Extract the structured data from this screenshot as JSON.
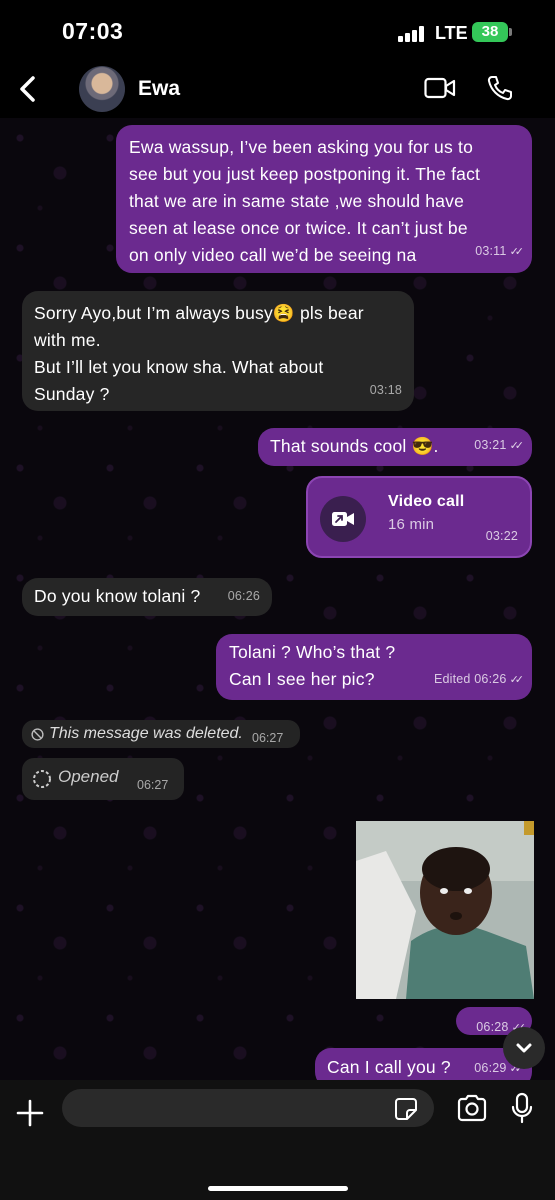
{
  "status_bar": {
    "time": "07:03",
    "network": "LTE",
    "battery": "38"
  },
  "header": {
    "contact_name": "Ewa"
  },
  "messages": [
    {
      "id": "m1",
      "direction": "out",
      "text": "Ewa wassup, I’ve been asking you for us to\nsee but you just keep postponing it. The fact\nthat we are in same state ,we should have\nseen at lease once or twice. It can’t just be\non only video call we’d be seeing na",
      "time": "03:11"
    },
    {
      "id": "m2",
      "direction": "in",
      "text": "Sorry Ayo,but I’m always busy😫 pls bear\nwith me.\nBut I’ll let you know sha. What about\nSunday ?",
      "time": "03:18"
    },
    {
      "id": "m3",
      "direction": "out",
      "text": "That sounds cool 😎.",
      "time": "03:21"
    },
    {
      "id": "m4",
      "direction": "out",
      "type": "call",
      "title": "Video call",
      "duration": "16 min",
      "time": "03:22"
    },
    {
      "id": "m5",
      "direction": "in",
      "text": "Do you know tolani ?",
      "time": "06:26"
    },
    {
      "id": "m6",
      "direction": "out",
      "text": "Tolani ? Who’s that ?\nCan I see her pic?",
      "edited_label": "Edited",
      "time": "06:26"
    },
    {
      "id": "m7",
      "direction": "in",
      "type": "deleted",
      "text": "This message was deleted.",
      "time": "06:27"
    },
    {
      "id": "m8",
      "direction": "in",
      "type": "view_once",
      "text": "Opened",
      "time": "06:27"
    },
    {
      "id": "m9",
      "direction": "out",
      "type": "image",
      "time": "06:28"
    },
    {
      "id": "m10",
      "direction": "out",
      "text": "Can I call you ?",
      "time": "06:29"
    }
  ],
  "input": {
    "placeholder": ""
  },
  "colors": {
    "outgoing_bubble": "#6b2a8f",
    "incoming_bubble": "#262626",
    "battery": "#34c759"
  }
}
